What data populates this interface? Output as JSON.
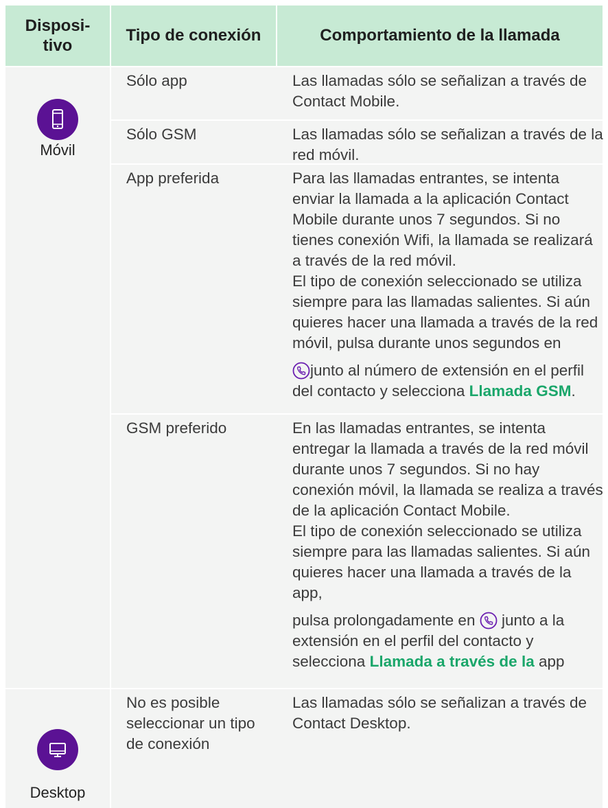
{
  "headers": {
    "dispositivo": "Disposi-\ntivo",
    "tipo": "Tipo de conexión",
    "comportamiento": "Comportamiento de la llamada"
  },
  "devices": {
    "movil": {
      "label": "Móvil",
      "icon": "smartphone-icon"
    },
    "desktop": {
      "label": "Desktop",
      "icon": "monitor-icon"
    }
  },
  "rows": [
    {
      "tipo": "Sólo app",
      "comp": "Las llamadas sólo se señalizan a través de Contact Mobile."
    },
    {
      "tipo": "Sólo GSM",
      "comp": "Las llamadas sólo se señalizan a través de la red móvil."
    },
    {
      "tipo": "App preferida",
      "comp_1": "Para las llamadas entrantes, se intenta enviar la llamada a la aplicación Contact Mobile durante unos 7 segundos. Si no tienes conexión Wifi, la llamada se realizará a través de la red móvil.",
      "comp_2": "El tipo de conexión seleccionado se utiliza siempre para las llamadas salientes. Si aún quieres hacer una llamada a través de la red móvil, pulsa durante unos segundos en",
      "comp_3": "junto al número de extensión en el perfil del contacto y selecciona ",
      "comp_hl": "Llamada GSM",
      "comp_end": "."
    },
    {
      "tipo": "GSM preferido",
      "comp_1": "En las llamadas entrantes, se intenta entregar la llamada a través de la red móvil durante unos 7 segundos. Si no hay conexión móvil, la llamada se realiza a través de la aplicación Contact Mobile.",
      "comp_2": "El tipo de conexión seleccionado se utiliza siempre para las llamadas salientes. Si aún quieres hacer una llamada a través de la app,",
      "comp_3a": "pulsa prolongadamente en ",
      "comp_3b": " junto a la extensión en el perfil del contacto y selecciona ",
      "comp_hl": "Llamada a través de la",
      "comp_end": " app"
    },
    {
      "tipo": "No es posible seleccionar un tipo de conexión",
      "comp": "Las llamadas sólo se señalizan a través de Contact Desktop."
    }
  ],
  "colors": {
    "header_bg": "#c7ead4",
    "icon_bg": "#5b1294",
    "highlight": "#1aa66a",
    "phone_icon": "#6a1fb0"
  }
}
